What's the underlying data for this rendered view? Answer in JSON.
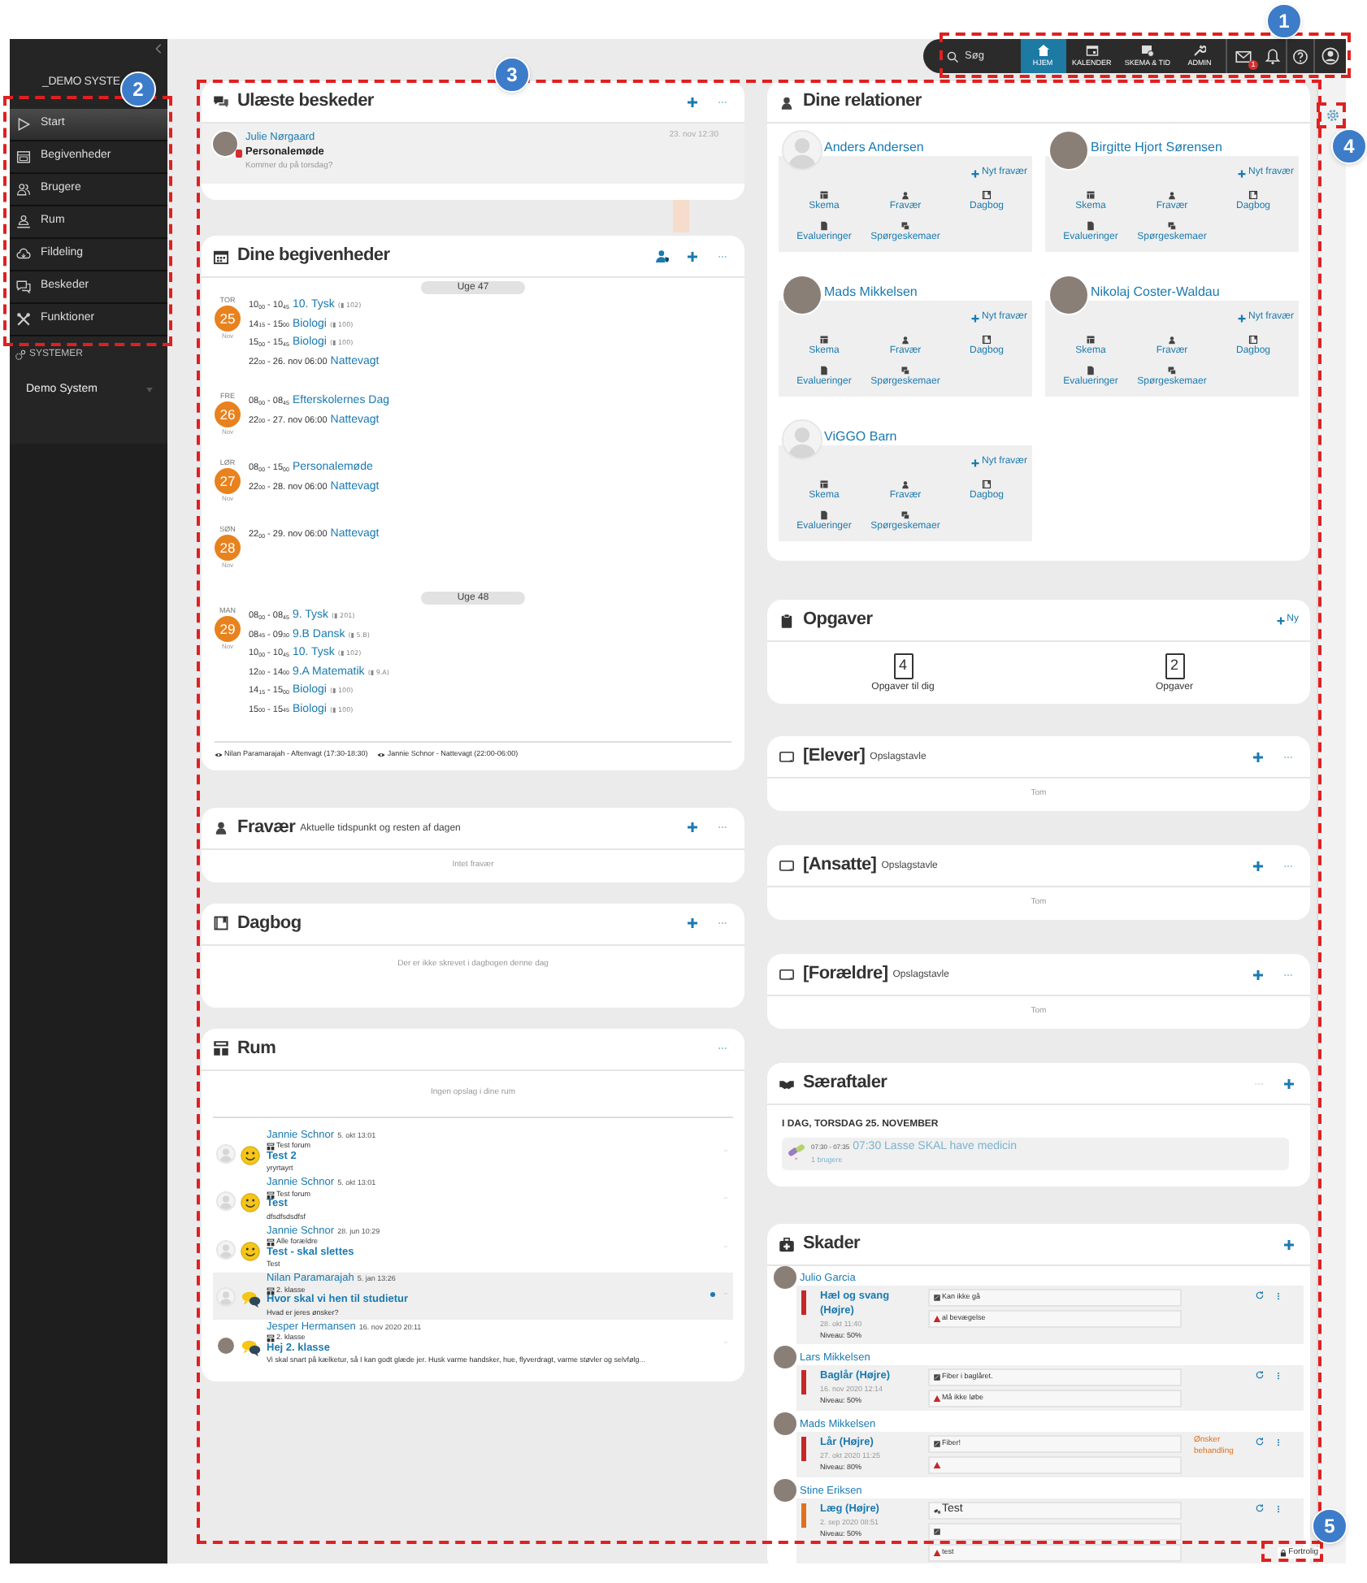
{
  "annotations": [
    {
      "number": "1"
    },
    {
      "number": "2"
    },
    {
      "number": "3"
    },
    {
      "number": "4"
    },
    {
      "number": "5"
    }
  ],
  "sidebar": {
    "title": "_DEMO SYSTE",
    "items": [
      {
        "label": "Start",
        "selected": true
      },
      {
        "label": "Begivenheder",
        "selected": false
      },
      {
        "label": "Brugere",
        "selected": false
      },
      {
        "label": "Rum",
        "selected": false
      },
      {
        "label": "Fildeling",
        "selected": false
      },
      {
        "label": "Beskeder",
        "selected": false
      },
      {
        "label": "Funktioner",
        "selected": false
      }
    ],
    "systems_heading": "SYSTEMER",
    "system": "Demo System"
  },
  "topbar": {
    "search_placeholder": "Søg",
    "nav": [
      {
        "label": "HJEM",
        "selected": true
      },
      {
        "label": "KALENDER",
        "selected": false
      },
      {
        "label": "SKEMA & TID",
        "selected": false
      },
      {
        "label": "ADMIN",
        "selected": false
      }
    ],
    "mail_badge": "1"
  },
  "unread_messages": {
    "title": "Ulæste beskeder",
    "messages": [
      {
        "sender": "Julie Nørgaard",
        "subject": "Personalemøde",
        "preview": "Kommer du på torsdag?",
        "time": "23. nov 12:30"
      }
    ]
  },
  "events": {
    "title": "Dine begivenheder",
    "weeks": [
      {
        "label": "Uge 47",
        "days": [
          {
            "weekday": "TOR",
            "day": "25",
            "month": "Nov",
            "items": [
              {
                "time": "10$_{00}$ - 10$_{45}$",
                "title": "10. Tysk",
                "room": "(▮ 102)"
              },
              {
                "time": "14$_{15}$ - 15$_{00}$",
                "title": "Biologi",
                "room": "(▮ 100)"
              },
              {
                "time": "15$_{00}$ - 15$_{45}$",
                "title": "Biologi",
                "room": "(▮ 100)"
              },
              {
                "time": "22$_{00}$ - 26. nov 06:00",
                "title": "Nattevagt"
              }
            ]
          },
          {
            "weekday": "FRE",
            "day": "26",
            "month": "Nov",
            "items": [
              {
                "time": "08$_{00}$ - 08$_{45}$",
                "title": "Efterskolernes Dag"
              },
              {
                "time": "22$_{00}$ - 27. nov 06:00",
                "title": "Nattevagt"
              }
            ]
          },
          {
            "weekday": "LØR",
            "day": "27",
            "month": "Nov",
            "items": [
              {
                "time": "08$_{00}$ - 15$_{00}$",
                "title": "Personalemøde"
              },
              {
                "time": "22$_{00}$ - 28. nov 06:00",
                "title": "Nattevagt"
              }
            ]
          },
          {
            "weekday": "SØN",
            "day": "28",
            "month": "Nov",
            "items": [
              {
                "time": "22$_{00}$ - 29. nov 06:00",
                "title": "Nattevagt"
              }
            ]
          }
        ]
      },
      {
        "label": "Uge 48",
        "days": [
          {
            "weekday": "MAN",
            "day": "29",
            "month": "Nov",
            "items": [
              {
                "time": "08$_{00}$ - 08$_{45}$",
                "title": "9. Tysk",
                "room": "(▮ 201)"
              },
              {
                "time": "08$_{45}$ - 09$_{30}$",
                "title": "9.B Dansk",
                "room": "(▮ 5.B)"
              },
              {
                "time": "10$_{00}$ - 10$_{45}$",
                "title": "10. Tysk",
                "room": "(▮ 102)"
              },
              {
                "time": "12$_{00}$ - 14$_{00}$",
                "title": "9.A Matematik",
                "room": "(▮ 9.A)"
              },
              {
                "time": "14$_{15}$ - 15$_{00}$",
                "title": "Biologi",
                "room": "(▮ 100)"
              },
              {
                "time": "15$_{00}$ - 15$_{45}$",
                "title": "Biologi",
                "room": "(▮ 100)"
              }
            ]
          }
        ]
      }
    ],
    "shifts": [
      "Nilan Paramarajah - Aftenvagt (17:30-18:30)",
      "Jannie Schnor - Nattevagt (22:00-06:00)"
    ]
  },
  "absence": {
    "title": "Fravær",
    "subtitle": "Aktuelle tidspunkt og resten af dagen",
    "empty": "Intet fravær"
  },
  "diary": {
    "title": "Dagbog",
    "empty": "Der er ikke skrevet i dagbogen denne dag"
  },
  "rooms": {
    "title": "Rum",
    "empty": "Ingen opslag i dine rum",
    "posts": [
      {
        "author": "Jannie Schnor",
        "time": "5. okt 13:01",
        "room": "Test forum",
        "title": "Test 2",
        "body": "yryrtayrt",
        "kind": "smiley",
        "unread": false,
        "has_photo": false
      },
      {
        "author": "Jannie Schnor",
        "time": "5. okt 13:01",
        "room": "Test forum",
        "title": "Test",
        "body": "dfsdfsdsdfsf",
        "kind": "smiley",
        "unread": false,
        "has_photo": false
      },
      {
        "author": "Jannie Schnor",
        "time": "28. jun 10:29",
        "room": "Alle forældre",
        "title": "Test - skal slettes",
        "body": "Test",
        "kind": "smiley",
        "unread": false,
        "has_photo": false
      },
      {
        "author": "Nilan Paramarajah",
        "time": "5. jan 13:26",
        "room": "2. klasse",
        "title": "Hvor skal vi hen til studietur",
        "body": "Hvad er jeres ønsker?",
        "kind": "chat",
        "unread": true,
        "has_photo": false
      },
      {
        "author": "Jesper Hermansen",
        "time": "16. nov 2020 20:11",
        "room": "2. klasse",
        "title": "Hej 2. klasse",
        "body": "Vi skal snart på kælketur, så I kan godt glæde jer. Husk varme handsker, hue, flyverdragt, varme støvler og selvfølg",
        "more": "...",
        "kind": "chat",
        "unread": false,
        "has_photo": true
      }
    ]
  },
  "relations": {
    "title": "Dine relationer",
    "people": [
      {
        "name": "Anders Andersen",
        "has_photo": false,
        "action": "Nyt fravær",
        "links": [
          "Skema",
          "Fravær",
          "Dagbog",
          "Evalueringer",
          "Spørgeskemaer"
        ]
      },
      {
        "name": "Birgitte Hjort Sørensen",
        "has_photo": true,
        "action": "Nyt fravær",
        "links": [
          "Skema",
          "Fravær",
          "Dagbog",
          "Evalueringer",
          "Spørgeskemaer"
        ]
      },
      {
        "name": "Mads Mikkelsen",
        "has_photo": true,
        "action": "Nyt fravær",
        "links": [
          "Skema",
          "Fravær",
          "Dagbog",
          "Evalueringer",
          "Spørgeskemaer"
        ]
      },
      {
        "name": "Nikolaj Coster-Waldau",
        "has_photo": true,
        "action": "Nyt fravær",
        "links": [
          "Skema",
          "Fravær",
          "Dagbog",
          "Evalueringer",
          "Spørgeskemaer"
        ]
      },
      {
        "name": "ViGGO Barn",
        "has_photo": false,
        "action": "Nyt fravær",
        "links": [
          "Skema",
          "Fravær",
          "Dagbog",
          "Evalueringer",
          "Spørgeskemaer"
        ]
      }
    ]
  },
  "tasks": {
    "title": "Opgaver",
    "new": "Ny",
    "tiles": [
      {
        "count": "4",
        "label": "Opgaver til dig"
      },
      {
        "count": "2",
        "label": "Opgaver"
      }
    ]
  },
  "boards": [
    {
      "title": "[Elever]",
      "subtitle": "Opslagstavle",
      "empty": "Tom"
    },
    {
      "title": "[Ansatte]",
      "subtitle": "Opslagstavle",
      "empty": "Tom"
    },
    {
      "title": "[Forældre]",
      "subtitle": "Opslagstavle",
      "empty": "Tom"
    }
  ],
  "agreements": {
    "title": "Særaftaler",
    "day_heading": "I DAG, TORSDAG 25. NOVEMBER",
    "items": [
      {
        "time": "07:30 - 07:35",
        "title": "07:30 Lasse SKAL have medicin",
        "users": "1 brugere"
      }
    ]
  },
  "injuries": {
    "title": "Skader",
    "entries": [
      {
        "person": "Julio Garcia",
        "injury": "Hæl og svang (Højre)",
        "date": "28. okt 11:40",
        "level_text": "Niveau: 50%",
        "color": "#c62828",
        "notes": [
          {
            "kind": "note",
            "text": "Kan ikke gå"
          },
          {
            "kind": "warning",
            "text": "al bevægelse"
          }
        ]
      },
      {
        "person": "Lars Mikkelsen",
        "injury": "Baglår (Højre)",
        "date": "16. nov 2020 12:14",
        "level_text": "Niveau: 50%",
        "color": "#c62828",
        "notes": [
          {
            "kind": "note",
            "text": "Fiber i baglåret."
          },
          {
            "kind": "warning",
            "text": "Må ikke løbe"
          }
        ]
      },
      {
        "person": "Mads Mikkelsen",
        "injury": "Lår (Højre)",
        "date": "27. okt 2020 11:25",
        "level_text": "Niveau: 80%",
        "color": "#c62828",
        "status": "Ønsker behandling",
        "notes": [
          {
            "kind": "note",
            "text": "Fiber!"
          },
          {
            "kind": "warning"
          }
        ]
      },
      {
        "person": "Stine Eriksen",
        "injury": "Læg (Højre)",
        "date": "2. sep 2020 08:51",
        "level_text": "Niveau: 50%",
        "color": "#e07020",
        "notes": [
          {
            "kind": "medicine",
            "text": "Test"
          },
          {
            "kind": "note"
          },
          {
            "kind": "warning",
            "text": "test"
          }
        ]
      }
    ]
  },
  "footer": {
    "confidential": "Fortrolig"
  }
}
